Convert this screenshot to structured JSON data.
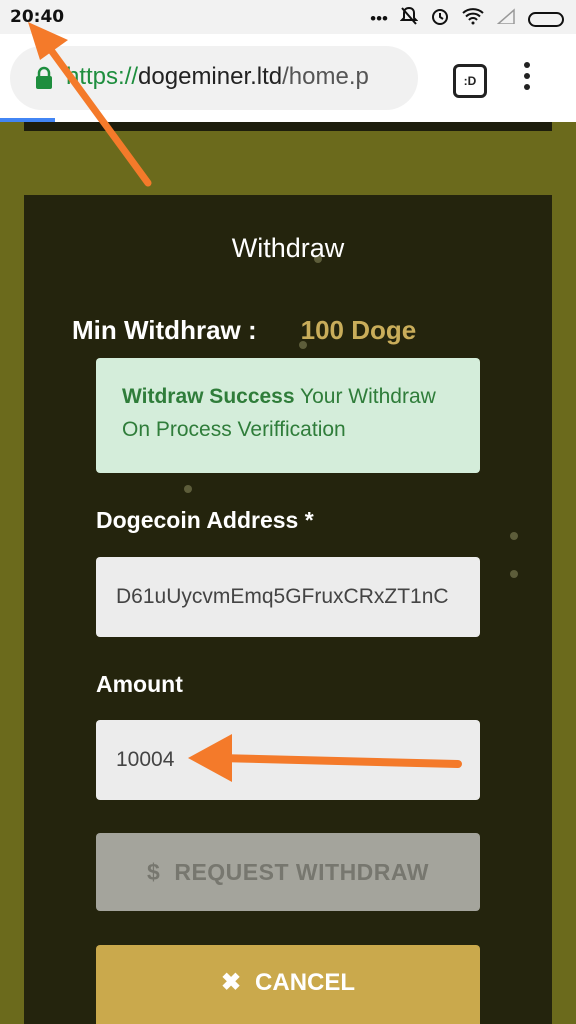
{
  "status_bar": {
    "time": "20:40",
    "icons": [
      "more-icon",
      "mute-bell-icon",
      "alarm-icon",
      "wifi-icon",
      "signal-icon",
      "battery-icon"
    ]
  },
  "browser": {
    "url_scheme": "https://",
    "url_host": "dogeminer.ltd",
    "url_path": "/home.p",
    "tabs_label": ":D"
  },
  "withdraw": {
    "title": "Withdraw",
    "min_label": "Min Witdhraw :",
    "min_value": "100 Doge",
    "alert_strong": "Witdraw Success",
    "alert_text": " Your Withdraw On Process Veriffication",
    "address_label": "Dogecoin Address *",
    "address_value": "D61uUycvmEmq5GFruxCRxZT1nC",
    "amount_label": "Amount",
    "amount_value": "10004",
    "request_label": "REQUEST WITHDRAW",
    "cancel_label": "CANCEL"
  },
  "colors": {
    "page_bg": "#6b6a1c",
    "card_bg": "#24240d",
    "accent_gold": "#c9ad5a",
    "alert_bg": "#d4edda",
    "arrow": "#f47a2a"
  }
}
